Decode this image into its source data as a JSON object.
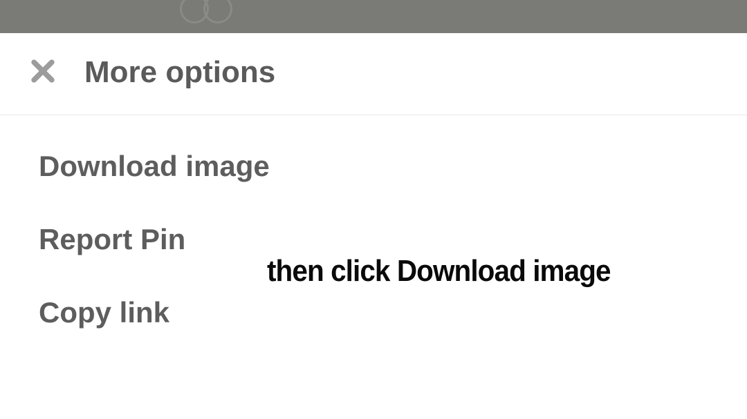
{
  "header": {
    "title": "More options"
  },
  "menu": {
    "items": [
      {
        "label": "Download image"
      },
      {
        "label": "Report Pin"
      },
      {
        "label": "Copy link"
      }
    ]
  },
  "annotation": {
    "text": "then click Download image"
  }
}
